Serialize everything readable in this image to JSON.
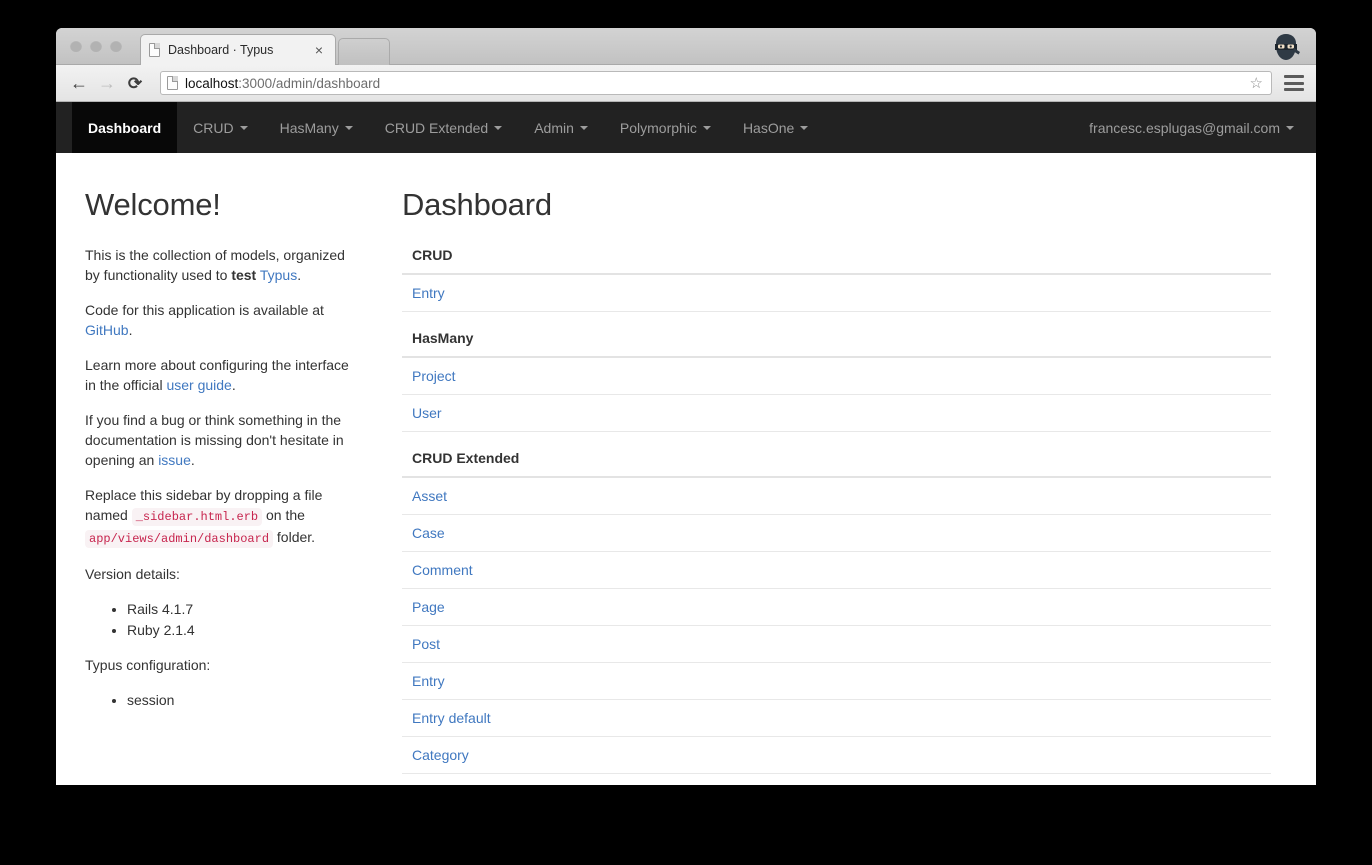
{
  "browser": {
    "tab_title": "Dashboard · Typus",
    "tab_close_label": "×",
    "back_label": "←",
    "forward_label": "→",
    "reload_label": "⟳",
    "url_host": "localhost",
    "url_path": ":3000/admin/dashboard",
    "star_label": "☆",
    "avatar_name": "ninja-avatar"
  },
  "navbar": {
    "brand": {
      "label": "Dashboard"
    },
    "items": [
      {
        "label": "CRUD",
        "caret": true
      },
      {
        "label": "HasMany",
        "caret": true
      },
      {
        "label": "CRUD Extended",
        "caret": true
      },
      {
        "label": "Admin",
        "caret": true
      },
      {
        "label": "Polymorphic",
        "caret": true
      },
      {
        "label": "HasOne",
        "caret": true
      }
    ],
    "user": {
      "label": "francesc.esplugas@gmail.com"
    }
  },
  "sidebar": {
    "title": "Welcome!",
    "p1_a": "This is the collection of models, organized by functionality used to ",
    "p1_bold": "test",
    "p1_b": " ",
    "p1_link": "Typus",
    "p1_c": ".",
    "p2_a": "Code for this application is available at ",
    "p2_link": "GitHub",
    "p2_b": ".",
    "p3_a": "Learn more about configuring the interface in the official ",
    "p3_link": "user guide",
    "p3_b": ".",
    "p4": "If you find a bug or think something in the documentation is missing don't hesitate in opening an ",
    "p4_link": "issue",
    "p4_b": ".",
    "p5_a": "Replace this sidebar by dropping a file named ",
    "p5_code1": "_sidebar.html.erb",
    "p5_b": " on the ",
    "p5_code2": "app/views/admin/dashboard",
    "p5_c": " folder.",
    "version_label": "Version details:",
    "versions": [
      "Rails 4.1.7",
      "Ruby 2.1.4"
    ],
    "config_label": "Typus configuration:",
    "config_items": [
      "session"
    ]
  },
  "main": {
    "title": "Dashboard",
    "groups": [
      {
        "title": "CRUD",
        "models": [
          "Entry"
        ]
      },
      {
        "title": "HasMany",
        "models": [
          "Project",
          "User"
        ]
      },
      {
        "title": "CRUD Extended",
        "models": [
          "Asset",
          "Case",
          "Comment",
          "Page",
          "Post",
          "Entry",
          "Entry default",
          "Category"
        ]
      }
    ]
  },
  "colors": {
    "navbar_bg": "#222222",
    "navbar_active_bg": "#080808",
    "link": "#4078c0",
    "code_text": "#c7254e",
    "code_bg": "#f9f2f4"
  }
}
